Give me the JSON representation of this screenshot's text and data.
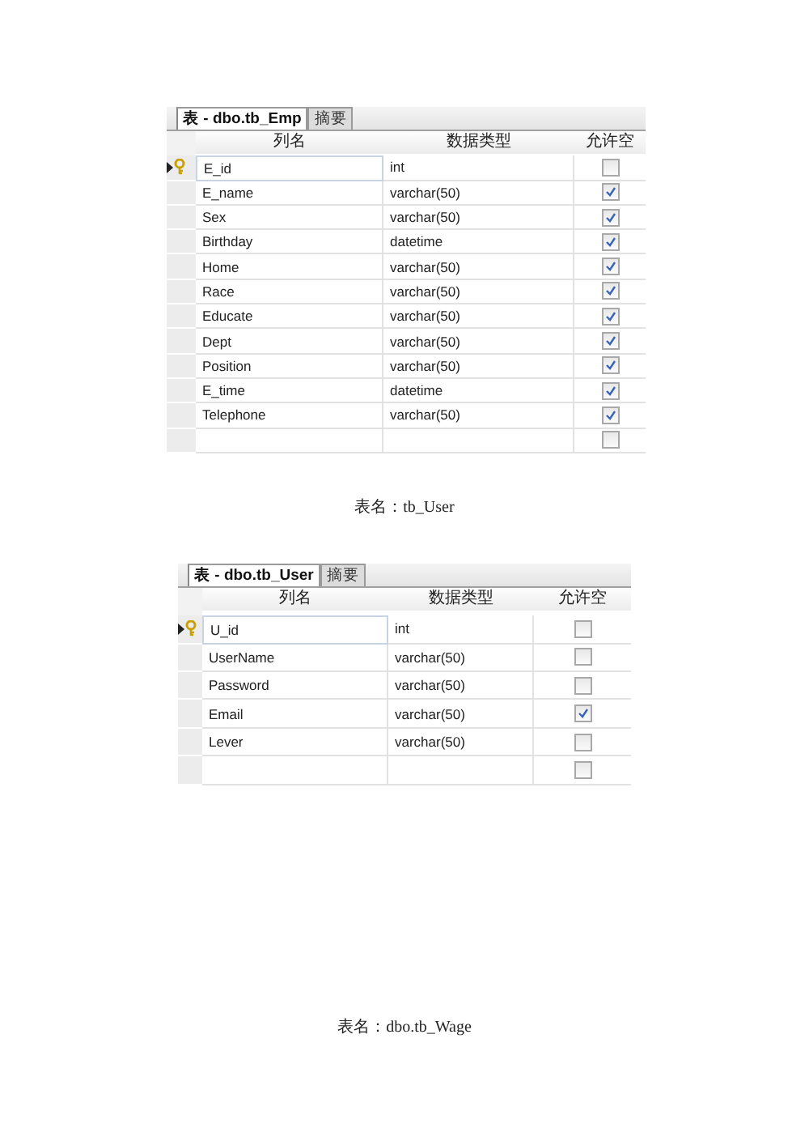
{
  "blocks": [
    {
      "kind": "designer",
      "tabs": [
        {
          "label": "表 - dbo.tb_Emp",
          "selected": true
        },
        {
          "label": "摘要",
          "selected": false
        }
      ],
      "columns": [
        "列名",
        "数据类型",
        "允许空"
      ],
      "rows": [
        {
          "name": "E_id",
          "type": "int",
          "allow_null": false,
          "primary_key": true,
          "selected": true
        },
        {
          "name": "E_name",
          "type": "varchar(50)",
          "allow_null": true,
          "primary_key": false,
          "selected": false
        },
        {
          "name": "Sex",
          "type": "varchar(50)",
          "allow_null": true,
          "primary_key": false,
          "selected": false
        },
        {
          "name": "Birthday",
          "type": "datetime",
          "allow_null": true,
          "primary_key": false,
          "selected": false
        },
        {
          "name": "Home",
          "type": "varchar(50)",
          "allow_null": true,
          "primary_key": false,
          "selected": false
        },
        {
          "name": "Race",
          "type": "varchar(50)",
          "allow_null": true,
          "primary_key": false,
          "selected": false
        },
        {
          "name": "Educate",
          "type": "varchar(50)",
          "allow_null": true,
          "primary_key": false,
          "selected": false
        },
        {
          "name": "Dept",
          "type": "varchar(50)",
          "allow_null": true,
          "primary_key": false,
          "selected": false
        },
        {
          "name": "Position",
          "type": "varchar(50)",
          "allow_null": true,
          "primary_key": false,
          "selected": false
        },
        {
          "name": "E_time",
          "type": "datetime",
          "allow_null": true,
          "primary_key": false,
          "selected": false
        },
        {
          "name": "Telephone",
          "type": "varchar(50)",
          "allow_null": true,
          "primary_key": false,
          "selected": false
        },
        {
          "allow_null": false,
          "primary_key": false,
          "selected": false
        }
      ]
    },
    {
      "kind": "caption",
      "text": "表名：tb_User"
    },
    {
      "kind": "designer",
      "tabs": [
        {
          "label": "表 - dbo.tb_User",
          "selected": true
        },
        {
          "label": "摘要",
          "selected": false
        }
      ],
      "columns": [
        "列名",
        "数据类型",
        "允许空"
      ],
      "rows": [
        {
          "name": "U_id",
          "type": "int",
          "allow_null": false,
          "primary_key": true,
          "selected": true
        },
        {
          "name": "UserName",
          "type": "varchar(50)",
          "allow_null": false,
          "primary_key": false,
          "selected": false
        },
        {
          "name": "Password",
          "type": "varchar(50)",
          "allow_null": false,
          "primary_key": false,
          "selected": false
        },
        {
          "name": "Email",
          "type": "varchar(50)",
          "allow_null": true,
          "primary_key": false,
          "selected": false
        },
        {
          "name": "Lever",
          "type": "varchar(50)",
          "allow_null": false,
          "primary_key": false,
          "selected": false
        },
        {
          "allow_null": false,
          "primary_key": false,
          "selected": false
        }
      ]
    },
    {
      "kind": "caption",
      "text": "表名：dbo.tb_Wage"
    }
  ]
}
